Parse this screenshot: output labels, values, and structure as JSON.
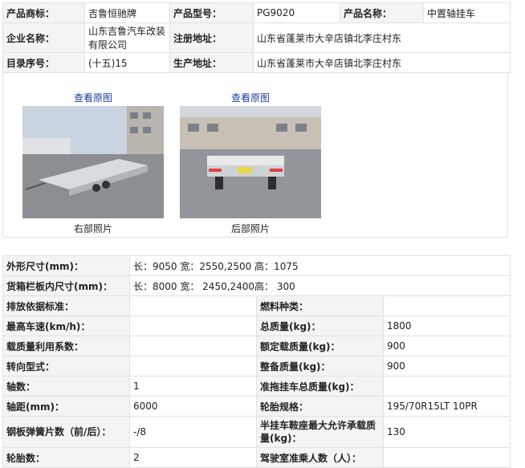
{
  "top": {
    "brand_label": "产品商标：",
    "brand_value": "吉鲁恒驰牌",
    "model_label": "产品型号：",
    "model_value": "PG9020",
    "name_label": "产品名称：",
    "name_value": "中置轴挂车",
    "company_label": "企业名称：",
    "company_value": "山东吉鲁汽车改装有限公司",
    "reg_addr_label": "注册地址：",
    "reg_addr_value": "山东省蓬莱市大辛店镇北李庄村东",
    "catalog_label": "目录序号：",
    "catalog_value": "(十五)15",
    "prod_addr_label": "生产地址：",
    "prod_addr_value": "山东省蓬莱市大辛店镇北李庄村东"
  },
  "photos": [
    {
      "link": "查看原图",
      "caption": "右部照片",
      "icon": "trailer-right-photo"
    },
    {
      "link": "查看原图",
      "caption": "后部照片",
      "icon": "trailer-rear-photo"
    }
  ],
  "spec": {
    "dims_label": "外形尺寸(mm)：",
    "dims_value": "长：9050 宽：2550,2500 高：1075",
    "cargo_label": "货箱栏板内尺寸(mm)：",
    "cargo_value": "长：8000 宽： 2450,2400高： 300",
    "emission_label": "排放依据标准：",
    "emission_value": "",
    "fuel_label": "燃料种类：",
    "fuel_value": "",
    "speed_label": "最高车速(km/h)：",
    "speed_value": "",
    "total_mass_label": "总质量(kg)：",
    "total_mass_value": "1800",
    "util_label": "载质量利用系数：",
    "util_value": "",
    "rated_load_label": "额定载质量(kg)：",
    "rated_load_value": "900",
    "steer_label": "转向型式：",
    "steer_value": "",
    "curb_label": "整备质量(kg)：",
    "curb_value": "900",
    "axles_label": "轴数：",
    "axles_value": "1",
    "tow_label": "准拖挂车总质量(kg)：",
    "tow_value": "",
    "wheelbase_label": "轴距(mm)：",
    "wheelbase_value": "6000",
    "tire_label": "轮胎规格：",
    "tire_value": "195/70R15LT 10PR",
    "spring_label": "钢板弹簧片数（前/后）：",
    "spring_value": "-/8",
    "saddle_label": "半挂车鞍座最大允许承载质量(kg)：",
    "saddle_value": "130",
    "tires_label": "轮胎数：",
    "tires_value": "2",
    "cab_label": "驾驶室准乘人数（人）：",
    "cab_value": ""
  }
}
